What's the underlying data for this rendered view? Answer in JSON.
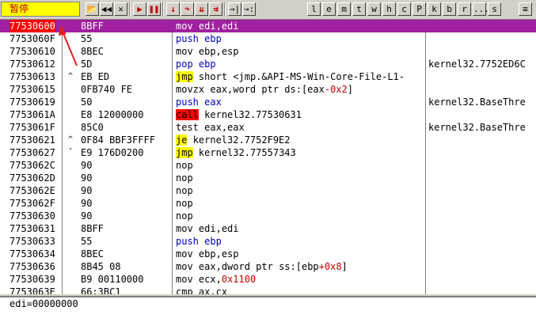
{
  "toolbar": {
    "status": "暂停",
    "buttons": [
      {
        "icon": "open-icon",
        "label": "📂"
      },
      {
        "icon": "restart-icon",
        "label": "◀◀"
      },
      {
        "icon": "close-icon",
        "label": "✕"
      },
      {
        "icon": "run-icon",
        "label": "▶"
      },
      {
        "icon": "pause-icon",
        "label": "❚❚"
      },
      {
        "icon": "step-into-icon",
        "label": "↓"
      },
      {
        "icon": "step-over-icon",
        "label": "↷"
      },
      {
        "icon": "trace-into-icon",
        "label": "⇊"
      },
      {
        "icon": "trace-over-icon",
        "label": "⇉"
      },
      {
        "icon": "execute-till-return-icon",
        "label": "→|"
      },
      {
        "icon": "goto-icon",
        "label": "→:"
      }
    ],
    "windows": [
      "l",
      "e",
      "m",
      "t",
      "w",
      "h",
      "c",
      "P",
      "k",
      "b",
      "r",
      "...",
      "s"
    ],
    "last_button": "≡"
  },
  "disasm": {
    "rows": [
      {
        "addr": "77530600",
        "mark": "",
        "hex": "8BFF",
        "mnem": "mov",
        "mclass": "",
        "ops": [
          {
            "t": "edi,edi",
            "c": ""
          }
        ],
        "comment": "",
        "selected": true
      },
      {
        "addr": "7753060F",
        "mark": "",
        "hex": "55",
        "mnem": "push",
        "mclass": "m-blue",
        "ops": [
          {
            "t": "ebp",
            "c": "m-blue"
          }
        ],
        "comment": ""
      },
      {
        "addr": "77530610",
        "mark": "",
        "hex": "8BEC",
        "mnem": "mov",
        "mclass": "",
        "ops": [
          {
            "t": "ebp,esp",
            "c": ""
          }
        ],
        "comment": ""
      },
      {
        "addr": "77530612",
        "mark": "",
        "hex": "5D",
        "mnem": "pop",
        "mclass": "m-blue",
        "ops": [
          {
            "t": "ebp",
            "c": "m-blue"
          }
        ],
        "comment": "kernel32.7752ED6C"
      },
      {
        "addr": "77530613",
        "mark": "^",
        "hex": "EB ED",
        "mnem": "jmp",
        "mclass": "m-jmp",
        "ops": [
          {
            "t": "short <jmp.&API-MS-Win-Core-File-L1-",
            "c": ""
          }
        ],
        "comment": ""
      },
      {
        "addr": "77530615",
        "mark": "",
        "hex": "0FB740 FE",
        "mnem": "movzx",
        "mclass": "",
        "ops": [
          {
            "t": "eax,word ptr ds:[eax",
            "c": ""
          },
          {
            "t": "-0x2",
            "c": "num"
          },
          {
            "t": "]",
            "c": ""
          }
        ],
        "comment": ""
      },
      {
        "addr": "77530619",
        "mark": "",
        "hex": "50",
        "mnem": "push",
        "mclass": "m-blue",
        "ops": [
          {
            "t": "eax",
            "c": "m-blue"
          }
        ],
        "comment": "kernel32.BaseThre"
      },
      {
        "addr": "7753061A",
        "mark": "",
        "hex": "E8 12000000",
        "mnem": "call",
        "mclass": "m-call",
        "ops": [
          {
            "t": "kernel32.77530631",
            "c": ""
          }
        ],
        "comment": ""
      },
      {
        "addr": "7753061F",
        "mark": "",
        "hex": "85C0",
        "mnem": "test",
        "mclass": "",
        "ops": [
          {
            "t": "eax,eax",
            "c": ""
          }
        ],
        "comment": "kernel32.BaseThre"
      },
      {
        "addr": "77530621",
        "mark": "^",
        "hex": "0F84 BBF3FFFF",
        "mnem": "je",
        "mclass": "m-jmp",
        "ops": [
          {
            "t": "kernel32.7752F9E2",
            "c": ""
          }
        ],
        "comment": ""
      },
      {
        "addr": "77530627",
        "mark": "ˇ",
        "hex": "E9 176D0200",
        "mnem": "jmp",
        "mclass": "m-jmp",
        "ops": [
          {
            "t": "kernel32.77557343",
            "c": ""
          }
        ],
        "comment": ""
      },
      {
        "addr": "7753062C",
        "mark": "",
        "hex": "90",
        "mnem": "nop",
        "mclass": "",
        "ops": [],
        "comment": ""
      },
      {
        "addr": "7753062D",
        "mark": "",
        "hex": "90",
        "mnem": "nop",
        "mclass": "",
        "ops": [],
        "comment": ""
      },
      {
        "addr": "7753062E",
        "mark": "",
        "hex": "90",
        "mnem": "nop",
        "mclass": "",
        "ops": [],
        "comment": ""
      },
      {
        "addr": "7753062F",
        "mark": "",
        "hex": "90",
        "mnem": "nop",
        "mclass": "",
        "ops": [],
        "comment": ""
      },
      {
        "addr": "77530630",
        "mark": "",
        "hex": "90",
        "mnem": "nop",
        "mclass": "",
        "ops": [],
        "comment": ""
      },
      {
        "addr": "77530631",
        "mark": "",
        "hex": "8BFF",
        "mnem": "mov",
        "mclass": "",
        "ops": [
          {
            "t": "edi,edi",
            "c": ""
          }
        ],
        "comment": ""
      },
      {
        "addr": "77530633",
        "mark": "",
        "hex": "55",
        "mnem": "push",
        "mclass": "m-blue",
        "ops": [
          {
            "t": "ebp",
            "c": "m-blue"
          }
        ],
        "comment": ""
      },
      {
        "addr": "77530634",
        "mark": "",
        "hex": "8BEC",
        "mnem": "mov",
        "mclass": "",
        "ops": [
          {
            "t": "ebp,esp",
            "c": ""
          }
        ],
        "comment": ""
      },
      {
        "addr": "77530636",
        "mark": "",
        "hex": "8B45 08",
        "mnem": "mov",
        "mclass": "",
        "ops": [
          {
            "t": "eax,dword ptr ss:[ebp",
            "c": ""
          },
          {
            "t": "+0x8",
            "c": "num"
          },
          {
            "t": "]",
            "c": ""
          }
        ],
        "comment": ""
      },
      {
        "addr": "77530639",
        "mark": "",
        "hex": "B9 00110000",
        "mnem": "mov",
        "mclass": "",
        "ops": [
          {
            "t": "ecx,",
            "c": ""
          },
          {
            "t": "0x1100",
            "c": "num"
          }
        ],
        "comment": ""
      },
      {
        "addr": "7753063E",
        "mark": "",
        "hex": "66:3BC1",
        "mnem": "cmp",
        "mclass": "",
        "ops": [
          {
            "t": "ax,cx",
            "c": ""
          }
        ],
        "comment": ""
      }
    ]
  },
  "info": {
    "text": "edi=00000000"
  },
  "colors": {
    "selection": "#a020a0",
    "call_bg": "#ff0000",
    "jump_bg": "#ffff00",
    "push_pop": "#0000c0",
    "status_bg": "#ffff00"
  }
}
